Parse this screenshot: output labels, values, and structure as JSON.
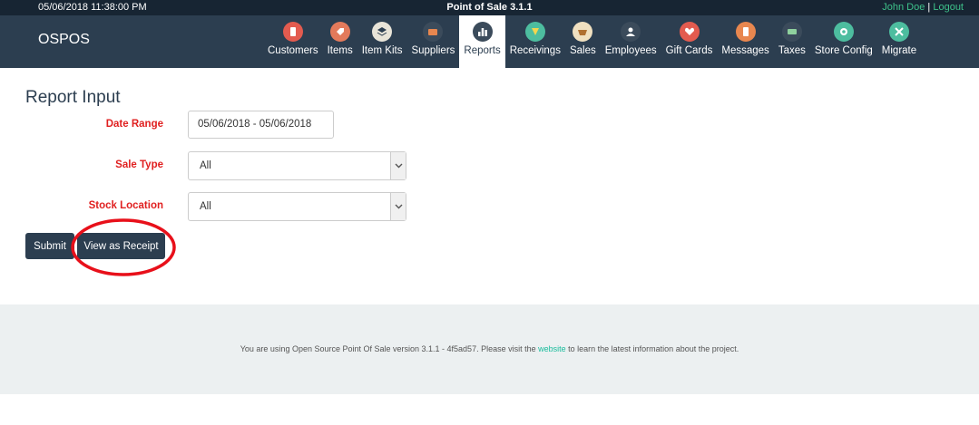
{
  "topbar": {
    "datetime": "05/06/2018 11:38:00 PM",
    "app_title": "Point of Sale 3.1.1",
    "user": "John Doe",
    "separator": "|",
    "logout": "Logout"
  },
  "navbar": {
    "brand": "OSPOS",
    "items": [
      {
        "label": "Customers",
        "icon": "customers-icon",
        "color": "#e35b4f"
      },
      {
        "label": "Items",
        "icon": "items-icon",
        "color": "#e37a5b"
      },
      {
        "label": "Item Kits",
        "icon": "item-kits-icon",
        "color": "#e8e4d8"
      },
      {
        "label": "Suppliers",
        "icon": "suppliers-icon",
        "color": "#3b4b5b"
      },
      {
        "label": "Reports",
        "icon": "reports-icon",
        "color": "#3b4b5b"
      },
      {
        "label": "Receivings",
        "icon": "receivings-icon",
        "color": "#4dbd9f"
      },
      {
        "label": "Sales",
        "icon": "sales-icon",
        "color": "#f0e0c0"
      },
      {
        "label": "Employees",
        "icon": "employees-icon",
        "color": "#3b4b5b"
      },
      {
        "label": "Gift Cards",
        "icon": "gift-cards-icon",
        "color": "#e35b4f"
      },
      {
        "label": "Messages",
        "icon": "messages-icon",
        "color": "#e8874f"
      },
      {
        "label": "Taxes",
        "icon": "taxes-icon",
        "color": "#3b4b5b"
      },
      {
        "label": "Store Config",
        "icon": "store-config-icon",
        "color": "#4dbd9f"
      },
      {
        "label": "Migrate",
        "icon": "migrate-icon",
        "color": "#4dbd9f"
      }
    ],
    "active": "Reports"
  },
  "main": {
    "title": "Report Input",
    "date_range_label": "Date Range",
    "date_range_value": "05/06/2018 - 05/06/2018",
    "sale_type_label": "Sale Type",
    "sale_type_value": "All",
    "stock_location_label": "Stock Location",
    "stock_location_value": "All",
    "submit_label": "Submit",
    "receipt_label": "View as Receipt"
  },
  "footer": {
    "text_before": "You are using Open Source Point Of Sale version 3.1.1 - 4f5ad57. Please visit the ",
    "link": "website",
    "text_after": " to learn the latest information about the project."
  },
  "colors": {
    "topbar": "#172533",
    "navbar": "#2c3e50",
    "label_red": "#e02020",
    "accent_green": "#3ec18a",
    "annotation_red": "#e8101a"
  }
}
